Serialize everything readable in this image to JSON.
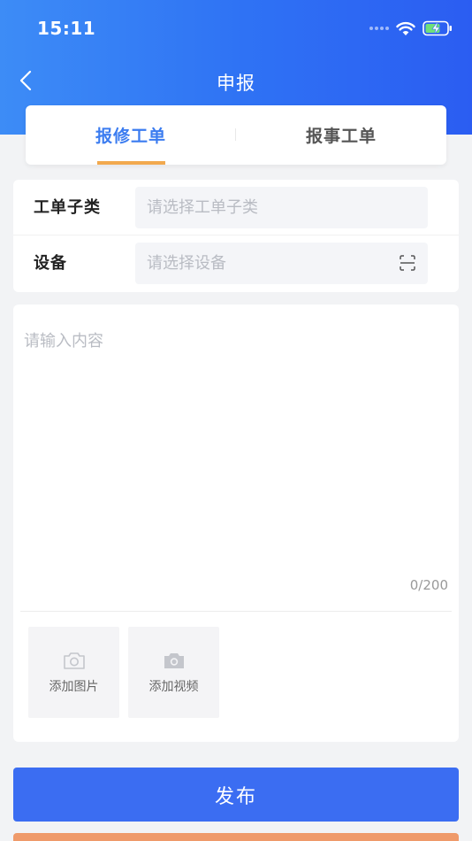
{
  "status_bar": {
    "time": "15:11"
  },
  "nav": {
    "title": "申报"
  },
  "tabs": [
    {
      "label": "报修工单",
      "active": true
    },
    {
      "label": "报事工单",
      "active": false
    }
  ],
  "form": {
    "subcategory": {
      "label": "工单子类",
      "placeholder": "请选择工单子类"
    },
    "device": {
      "label": "设备",
      "placeholder": "请选择设备"
    }
  },
  "content": {
    "placeholder": "请输入内容",
    "char_count": "0/200"
  },
  "media": {
    "add_image_label": "添加图片",
    "add_video_label": "添加视频"
  },
  "submit": {
    "label": "发布"
  },
  "colors": {
    "header_gradient_start": "#3d8cf6",
    "header_gradient_end": "#2b5df2",
    "tab_active": "#3b7cf0",
    "tab_indicator": "#f2a94e",
    "submit_button": "#3b6df2",
    "secondary_button": "#ef9a6a"
  }
}
